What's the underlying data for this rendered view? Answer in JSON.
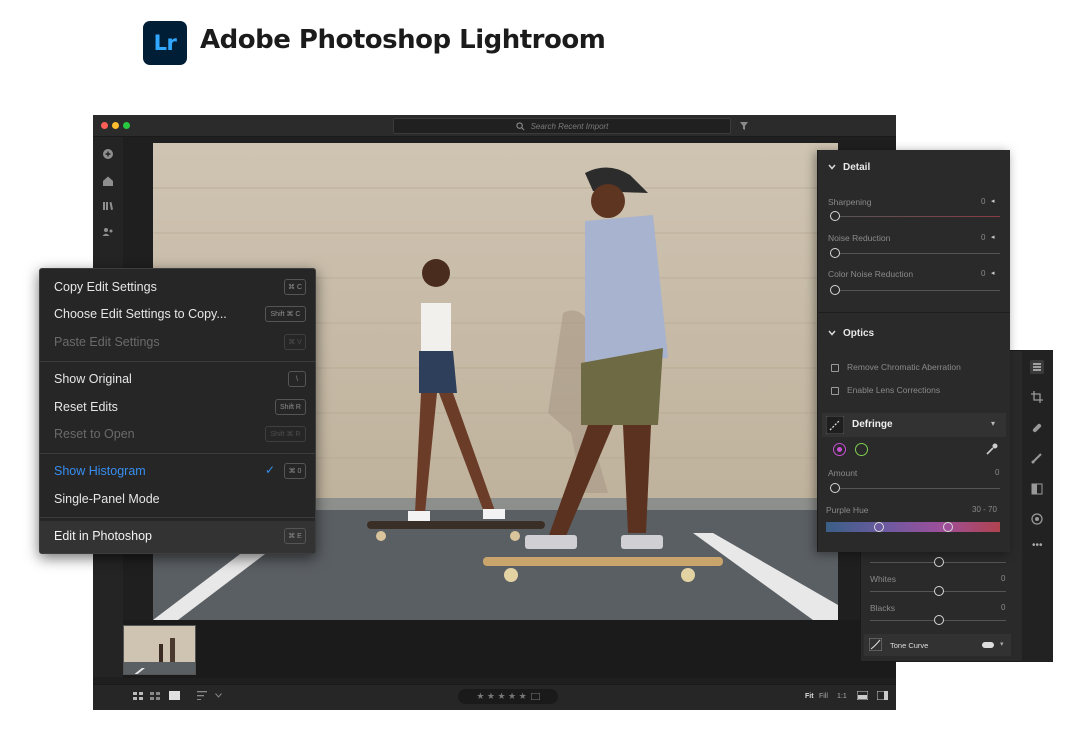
{
  "brand": {
    "logo_text": "Lr",
    "title": "Adobe Photoshop Lightroom"
  },
  "titlebar": {
    "search_placeholder": "Search Recent Import"
  },
  "context_menu": {
    "items": [
      {
        "label": "Copy Edit Settings",
        "shortcut": "⌘ C",
        "disabled": false
      },
      {
        "label": "Choose Edit Settings to Copy...",
        "shortcut": "Shift ⌘ C",
        "disabled": false
      },
      {
        "label": "Paste Edit Settings",
        "shortcut": "⌘ V",
        "disabled": true
      },
      {
        "label": "Show Original",
        "shortcut": "\\",
        "disabled": false
      },
      {
        "label": "Reset Edits",
        "shortcut": "Shift R",
        "disabled": false
      },
      {
        "label": "Reset to Open",
        "shortcut": "Shift ⌘ R",
        "disabled": true
      },
      {
        "label": "Show Histogram",
        "shortcut": "⌘ 0",
        "disabled": false,
        "checked": true
      },
      {
        "label": "Single-Panel Mode",
        "shortcut": "",
        "disabled": false
      },
      {
        "label": "Edit in Photoshop",
        "shortcut": "⌘ E",
        "disabled": false
      }
    ]
  },
  "detail_panel": {
    "header": "Detail",
    "sliders": [
      {
        "label": "Sharpening",
        "value": "0"
      },
      {
        "label": "Noise Reduction",
        "value": "0"
      },
      {
        "label": "Color Noise Reduction",
        "value": "0"
      }
    ]
  },
  "optics_panel": {
    "header": "Optics",
    "checkboxes": [
      {
        "label": "Remove Chromatic Aberration",
        "checked": false
      },
      {
        "label": "Enable Lens Corrections",
        "checked": false
      }
    ],
    "defringe": {
      "title": "Defringe",
      "amount_label": "Amount",
      "amount_value": "0",
      "purple_hue_label": "Purple Hue",
      "purple_hue_value": "30 - 70"
    }
  },
  "tone_panel": {
    "sliders": [
      {
        "label": "Whites",
        "value": "0"
      },
      {
        "label": "Blacks",
        "value": "0"
      }
    ],
    "tone_curve_label": "Tone Curve"
  },
  "bottombar": {
    "stars": "★ ★ ★ ★ ★",
    "fit_label": "Fit",
    "zoom_1": "Fill",
    "zoom_2": "1:1"
  },
  "colors": {
    "accent_blue": "#378ef0",
    "defringe_purple": "#c94fd6",
    "defringe_green": "#7ecf4f",
    "lr_brand": "#31a8ff"
  }
}
